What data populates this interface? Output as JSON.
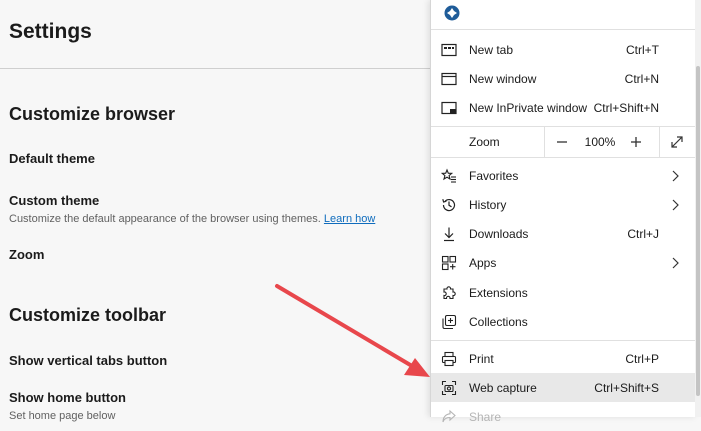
{
  "settings": {
    "title": "Settings",
    "customize_browser": {
      "heading": "Customize browser",
      "default_theme": "Default theme",
      "custom_theme": "Custom theme",
      "custom_theme_desc": "Customize the default appearance of the browser using themes.",
      "learn_more": "Learn how",
      "zoom": "Zoom"
    },
    "customize_toolbar": {
      "heading": "Customize toolbar",
      "vertical_tabs": "Show vertical tabs button",
      "home_button": "Show home button",
      "home_desc": "Set home page below"
    }
  },
  "menu": {
    "new_tab": {
      "label": "New tab",
      "shortcut": "Ctrl+T",
      "icon": "new-tab-icon"
    },
    "new_window": {
      "label": "New window",
      "shortcut": "Ctrl+N",
      "icon": "new-window-icon"
    },
    "new_inprivate": {
      "label": "New InPrivate window",
      "shortcut": "Ctrl+Shift+N",
      "icon": "inprivate-icon"
    },
    "zoom": {
      "label": "Zoom",
      "minus": "—",
      "value": "100%",
      "plus": "+"
    },
    "favorites": {
      "label": "Favorites",
      "icon": "star-icon"
    },
    "history": {
      "label": "History",
      "icon": "history-icon"
    },
    "downloads": {
      "label": "Downloads",
      "shortcut": "Ctrl+J",
      "icon": "download-icon"
    },
    "apps": {
      "label": "Apps",
      "icon": "apps-icon"
    },
    "extensions": {
      "label": "Extensions",
      "icon": "puzzle-icon"
    },
    "collections": {
      "label": "Collections",
      "icon": "collections-icon"
    },
    "print": {
      "label": "Print",
      "shortcut": "Ctrl+P",
      "icon": "printer-icon"
    },
    "web_capture": {
      "label": "Web capture",
      "shortcut": "Ctrl+Shift+S",
      "icon": "web-capture-icon"
    },
    "share": {
      "label": "Share",
      "icon": "share-icon"
    }
  },
  "colors": {
    "link": "#0f6cbd",
    "arrow": "#e8474c",
    "highlight": "#e8e8e8"
  }
}
